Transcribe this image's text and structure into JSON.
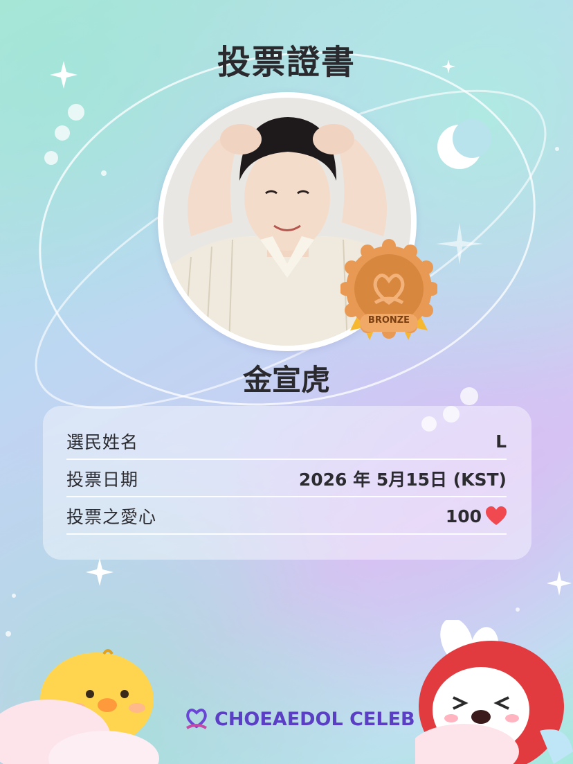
{
  "certificate": {
    "title": "投票證書",
    "candidate_name": "金宣虎",
    "badge_label": "BRONZE"
  },
  "details": [
    {
      "label": "選民姓名",
      "value": "L"
    },
    {
      "label": "投票日期",
      "value": "2026 年 5月15日 (KST)"
    },
    {
      "label": "投票之愛心",
      "value": "100"
    }
  ],
  "brand": {
    "name": "CHOEAEDOL CELEB",
    "color": "#5a3fc4"
  },
  "colors": {
    "heart": "#f0494f",
    "bronze": "#d98a45",
    "ribbon": "#f5b830"
  }
}
